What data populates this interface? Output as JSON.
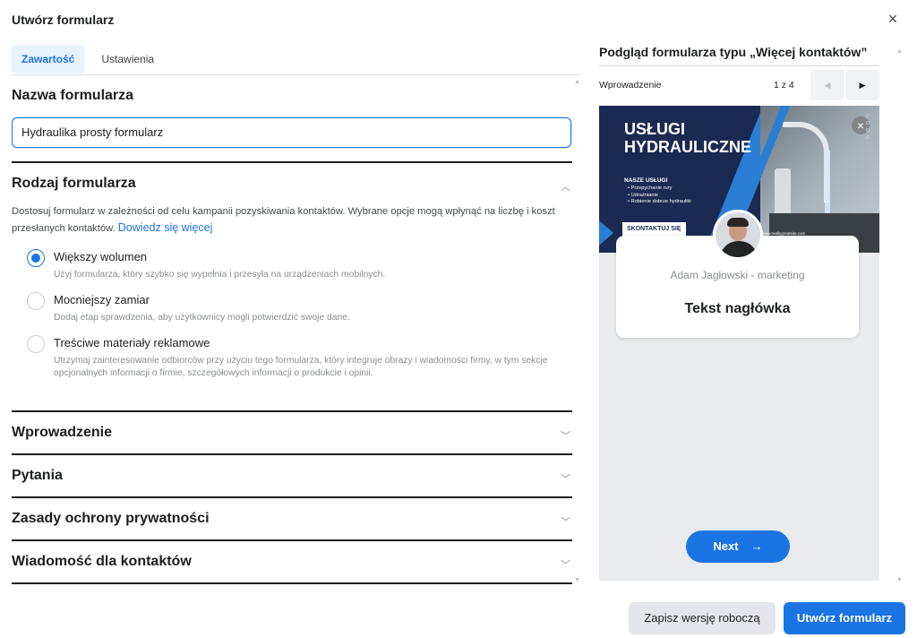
{
  "dialog": {
    "title": "Utwórz formularz",
    "close_icon": "×"
  },
  "tabs": [
    {
      "label": "Zawartość",
      "active": true
    },
    {
      "label": "Ustawienia",
      "active": false
    }
  ],
  "form_name": {
    "title": "Nazwa formularza",
    "value": "Hydraulika prosty formularz"
  },
  "form_type": {
    "title": "Rodzaj formularza",
    "description": "Dostosuj formularz w zależności od celu kampanii pozyskiwania kontaktów. Wybrane opcje mogą wpłynąć na liczbę i koszt przesłanych kontaktów.",
    "link": "Dowiedz się więcej",
    "options": [
      {
        "label": "Większy wolumen",
        "sub": "Użyj formularza, który szybko się wypełnia i przesyła na urządzeniach mobilnych.",
        "checked": true
      },
      {
        "label": "Mocniejszy zamiar",
        "sub": "Dodaj etap sprawdzenia, aby użytkownicy mogli potwierdzić swoje dane.",
        "checked": false
      },
      {
        "label": "Treściwe materiały reklamowe",
        "sub": "Utrzymaj zainteresowanie odbiorców przy użyciu tego formularza, który integruje obrazy i wiadomości firmy, w tym sekcje opcjonalnych informacji o firmie, szczegółowych informacji o produkcie i opinii.",
        "checked": false
      }
    ]
  },
  "sections": [
    {
      "label": "Wprowadzenie"
    },
    {
      "label": "Pytania"
    },
    {
      "label": "Zasady ochrony prywatności"
    },
    {
      "label": "Wiadomość dla kontaktów"
    }
  ],
  "preview": {
    "title": "Podgląd formularza typu „Więcej kontaktów”",
    "step_label": "Wprowadzenie",
    "step_count": "1 z 4",
    "banner": {
      "headline_1": "USŁUGI",
      "headline_2": "HYDRAULICZNE",
      "services_title": "NASZE USŁUGI",
      "services": [
        "• Przepychanie rury",
        "• Udrażnianie",
        "• Robienie dobrze hydrauliki"
      ],
      "cta": "SKONTAKTUJ SIĘ",
      "footer": "123-456-7890 | www.reallygreatsite.com"
    },
    "card_name": "Adam Jagłowski - marketing",
    "card_heading": "Tekst nagłówka",
    "next_label": "Next",
    "next_arrow": "→"
  },
  "footer": {
    "draft_label": "Zapisz wersję roboczą",
    "create_label": "Utwórz formularz"
  },
  "colors": {
    "accent": "#1b74e4",
    "banner_bg": "#1a2a52",
    "banner_stripe": "#2a7fd4"
  }
}
